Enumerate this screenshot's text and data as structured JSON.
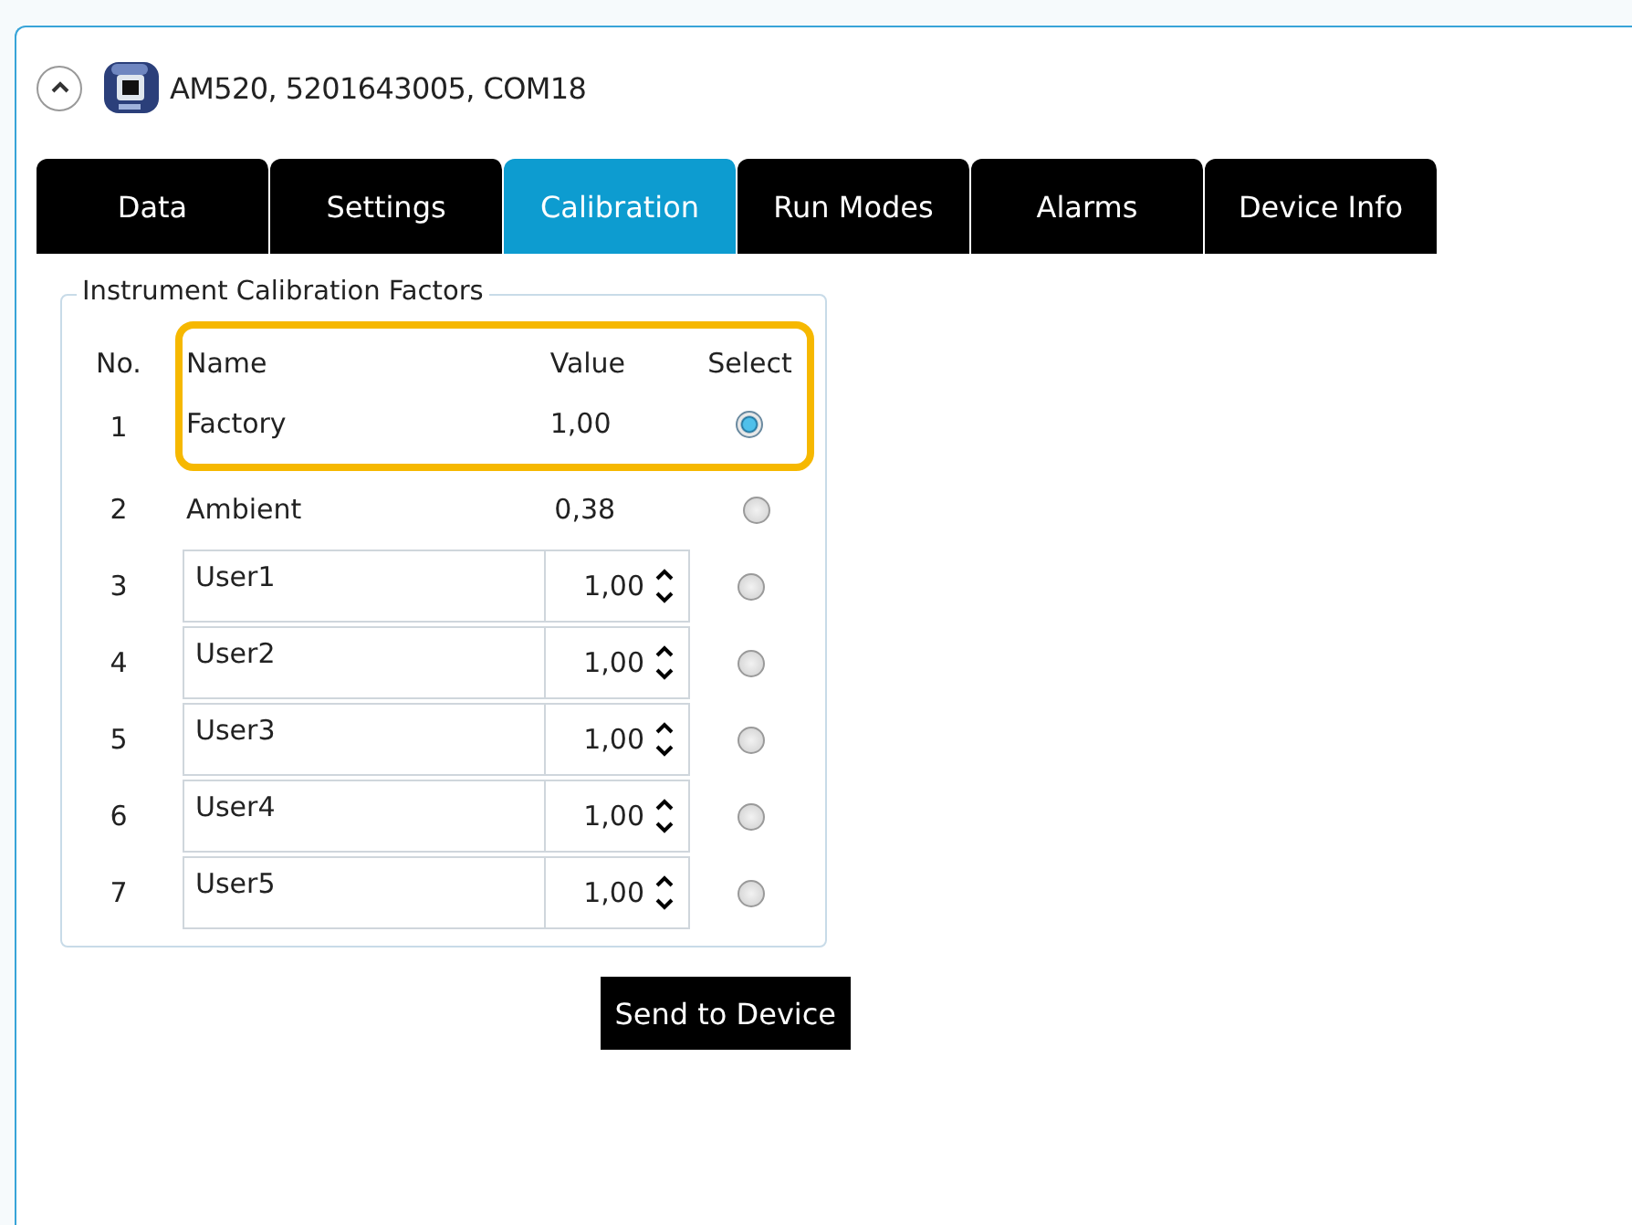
{
  "device": {
    "title": "AM520, 5201643005, COM18",
    "expanded": true
  },
  "tabs": [
    {
      "label": "Data",
      "selected": false
    },
    {
      "label": "Settings",
      "selected": false
    },
    {
      "label": "Calibration",
      "selected": true
    },
    {
      "label": "Run Modes",
      "selected": false
    },
    {
      "label": "Alarms",
      "selected": false
    },
    {
      "label": "Device Info",
      "selected": false
    }
  ],
  "group": {
    "title": "Instrument Calibration Factors",
    "columns": [
      "No.",
      "Name",
      "Value",
      "Select"
    ],
    "rows": [
      {
        "no": "1",
        "kind": "fixed",
        "name": "Factory",
        "value": "1,00",
        "selected": true,
        "highlighted": true
      },
      {
        "no": "2",
        "kind": "fixed",
        "name": "Ambient",
        "value": "0,38",
        "selected": false,
        "highlighted": false
      },
      {
        "no": "3",
        "kind": "editable",
        "name": "User1",
        "value": "1,00",
        "selected": false,
        "highlighted": false
      },
      {
        "no": "4",
        "kind": "editable",
        "name": "User2",
        "value": "1,00",
        "selected": false,
        "highlighted": false
      },
      {
        "no": "5",
        "kind": "editable",
        "name": "User3",
        "value": "1,00",
        "selected": false,
        "highlighted": false
      },
      {
        "no": "6",
        "kind": "editable",
        "name": "User4",
        "value": "1,00",
        "selected": false,
        "highlighted": false
      },
      {
        "no": "7",
        "kind": "editable",
        "name": "User5",
        "value": "1,00",
        "selected": false,
        "highlighted": false
      }
    ]
  },
  "button": "Send to Device"
}
